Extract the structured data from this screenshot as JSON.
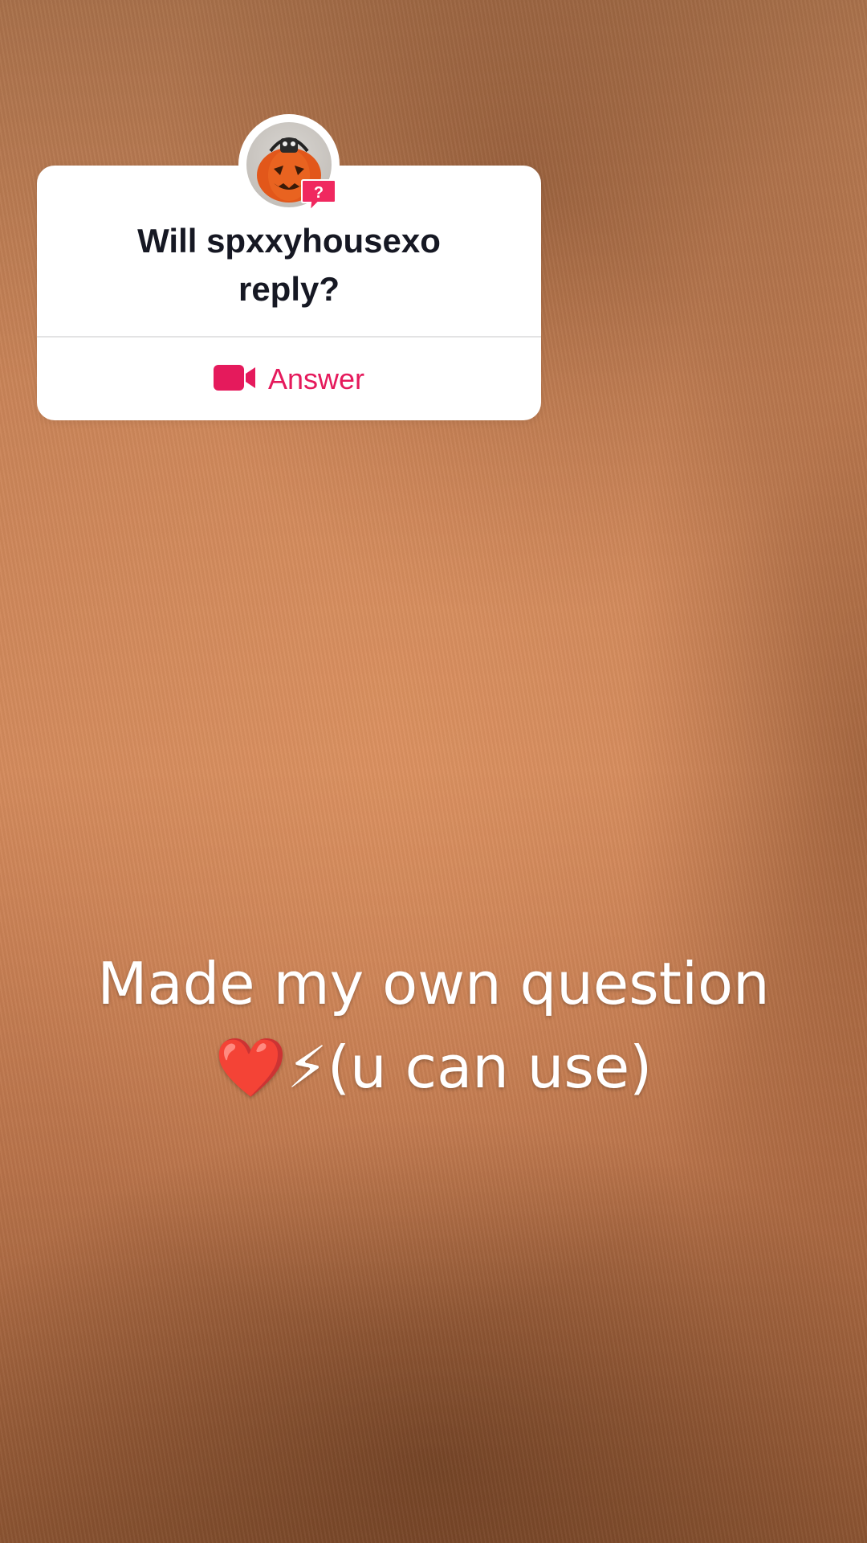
{
  "question_card": {
    "question_line1": "Will spxxyhousexo",
    "question_line2": "reply?",
    "answer_label": "Answer",
    "accent_color": "#e51a5c",
    "avatar_icon": "jack-o-lantern-avatar",
    "badge_icon": "question-bubble-icon",
    "answer_icon": "video-camera-icon"
  },
  "caption": {
    "line1": "Made my own question",
    "line2": "❤️⚡(u can use)"
  }
}
